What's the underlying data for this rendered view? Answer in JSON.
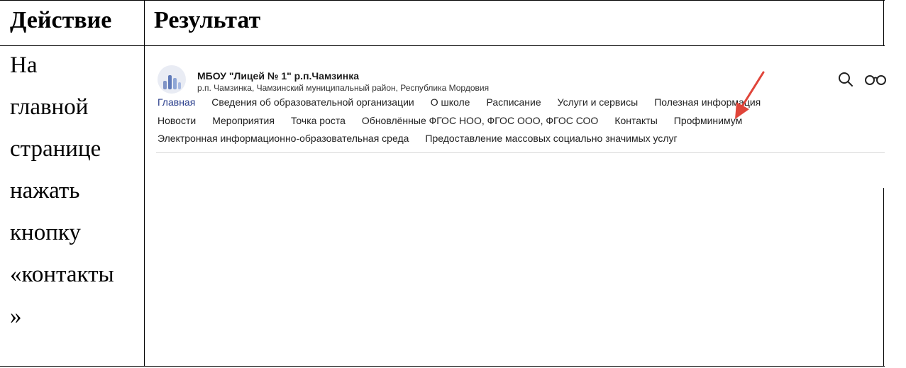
{
  "table": {
    "header": {
      "action": "Действие",
      "result": "Результат"
    },
    "action_lines": [
      "На",
      "главной",
      "странице",
      "нажать",
      "кнопку",
      "«контакты",
      "»"
    ]
  },
  "site": {
    "org_name": "МБОУ \"Лицей № 1\" р.п.Чамзинка",
    "org_address": "р.п. Чамзинка, Чамзинский муниципальный район, Республика Мордовия",
    "nav": {
      "row1": [
        "Главная",
        "Сведения об образовательной организации",
        "О школе",
        "Расписание",
        "Услуги и сервисы",
        "Полезная информация"
      ],
      "row2": [
        "Новости",
        "Мероприятия",
        "Точка роста",
        "Обновлённые ФГОС НОО, ФГОС ООО, ФГОС СОО",
        "Контакты",
        "Профминимум"
      ],
      "row3": [
        "Электронная информационно-образовательная среда",
        "Предоставление массовых социально значимых услуг"
      ]
    },
    "icons": [
      "search-icon",
      "glasses-icon",
      "logo"
    ],
    "colors": {
      "active_link": "#2a3e8c",
      "arrow": "#e0453a"
    }
  }
}
